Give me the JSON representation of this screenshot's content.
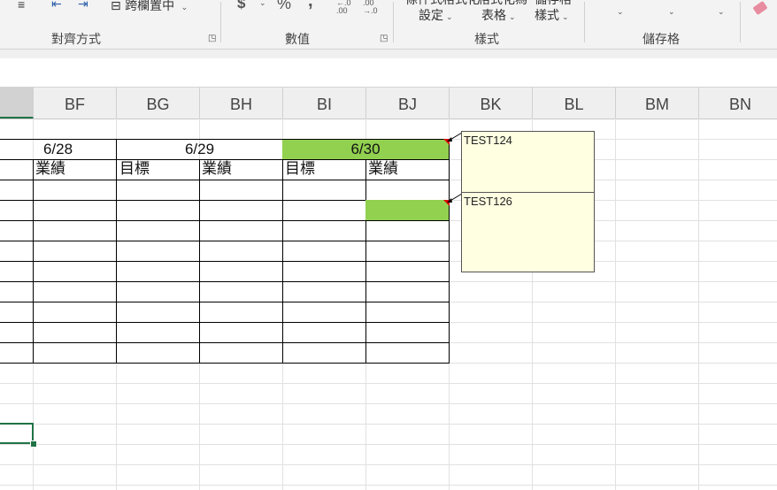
{
  "ribbon": {
    "merge_center_label": "跨欄置中",
    "percent_symbol": "%",
    "comma_symbol": ",",
    "dollar_symbol": "$",
    "dec_increase": "←.0 .00",
    "dec_decrease": ".00 →.0",
    "cond_format_label": "設定",
    "format_table_label": "表格",
    "cell_styles_label": "樣式",
    "cond_top": "條件式格式化",
    "table_top": "格式化為",
    "styles_top": "儲存格",
    "groups": {
      "alignment": "對齊方式",
      "number": "數值",
      "styles": "樣式",
      "cells": "儲存格"
    }
  },
  "columns": [
    "BF",
    "BG",
    "BH",
    "BI",
    "BJ",
    "BK",
    "BL",
    "BM",
    "BN"
  ],
  "table": {
    "dates": [
      "6/28",
      "6/29",
      "6/30"
    ],
    "header_row": [
      "業績",
      "目標",
      "業績",
      "目標",
      "業績"
    ]
  },
  "comments": [
    {
      "text": "TEST124"
    },
    {
      "text": "TEST126"
    }
  ],
  "colors": {
    "highlight": "#92d050",
    "comment_bg": "#ffffe1",
    "comment_marker": "#e00000",
    "selection": "#217346"
  }
}
